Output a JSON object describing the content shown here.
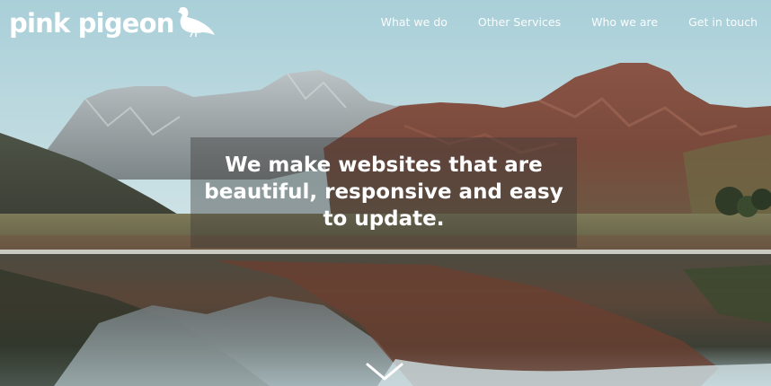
{
  "brand": {
    "name": "pink pigeon",
    "logo_icon": "pigeon-icon"
  },
  "nav": {
    "items": [
      {
        "label": "What we do"
      },
      {
        "label": "Other Services"
      },
      {
        "label": "Who we are"
      },
      {
        "label": "Get in touch"
      }
    ]
  },
  "hero": {
    "tagline": "We make websites that are beautiful, responsive and easy to update.",
    "scroll_icon": "chevron-down-icon"
  },
  "colors": {
    "text": "#ffffff",
    "overlay": "#3c3a38"
  }
}
